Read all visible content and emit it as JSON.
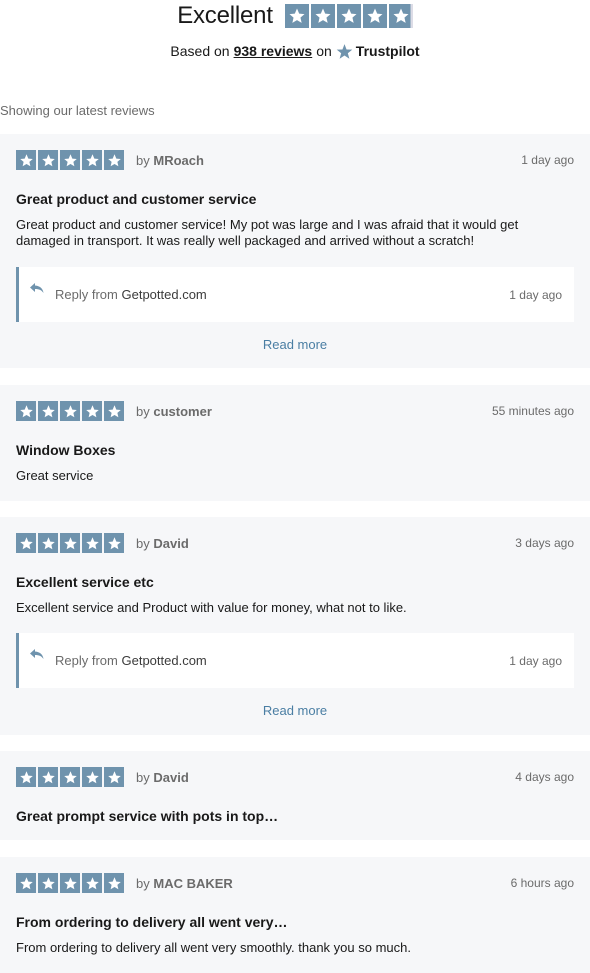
{
  "summary": {
    "rating_word": "Excellent",
    "based_prefix": "Based on",
    "review_count": "938 reviews",
    "based_on_suffix": "on",
    "brand": "Trustpilot",
    "rating_fraction": 0.9
  },
  "list_caption": "Showing our latest reviews",
  "colors": {
    "star": "#6f93ad",
    "star_empty": "#dcdce6",
    "card_bg": "#f6f7f9",
    "link": "#4a7ea3"
  },
  "reviews": [
    {
      "by_label": "by",
      "author": "MRoach",
      "date": "1 day ago",
      "stars": 5,
      "title": "Great product and customer service",
      "body": "Great product and customer service! My pot was large and I was afraid that it would get damaged in transport. It was really well packaged and arrived without a scratch!",
      "reply": {
        "prefix": "Reply from",
        "company": "Getpotted.com",
        "date": "1 day ago"
      },
      "read_more": "Read more"
    },
    {
      "by_label": "by",
      "author": "customer",
      "date": "55 minutes ago",
      "stars": 5,
      "title": "Window Boxes",
      "body": "Great service"
    },
    {
      "by_label": "by",
      "author": "David",
      "date": "3 days ago",
      "stars": 5,
      "title": "Excellent service etc",
      "body": "Excellent service and Product with value for money, what not to like.",
      "reply": {
        "prefix": "Reply from",
        "company": "Getpotted.com",
        "date": "1 day ago"
      },
      "read_more": "Read more"
    },
    {
      "by_label": "by",
      "author": "David",
      "date": "4 days ago",
      "stars": 5,
      "title": "Great prompt service with pots in top…"
    },
    {
      "by_label": "by",
      "author": "MAC BAKER",
      "date": "6 hours ago",
      "stars": 5,
      "title": "From ordering to delivery all went very…",
      "body": "From ordering to delivery all went very smoothly. thank you so much."
    }
  ]
}
